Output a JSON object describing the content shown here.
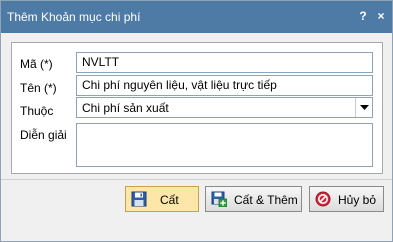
{
  "window": {
    "title": "Thêm Khoản mục chi phí",
    "help_glyph": "?",
    "close_glyph": "×"
  },
  "form": {
    "code_label": "Mã (*)",
    "code_value": "NVLTT",
    "name_label": "Tên (*)",
    "name_value": "Chi phí nguyên liệu, vật liệu trực tiếp",
    "parent_label": "Thuộc",
    "parent_value": "Chi phí sản xuất",
    "description_label": "Diễn giải",
    "description_value": ""
  },
  "buttons": {
    "save_label": "Cất",
    "save_add_label": "Cất & Thêm",
    "cancel_label": "Hủy bỏ"
  },
  "icons": {
    "save": "floppy-disk-icon",
    "save_add": "floppy-add-icon",
    "cancel": "cancel-icon"
  },
  "colors": {
    "titlebar": "#4e7aa6",
    "primary_button": "#fde7a8",
    "input_border": "#8fa3b8"
  }
}
